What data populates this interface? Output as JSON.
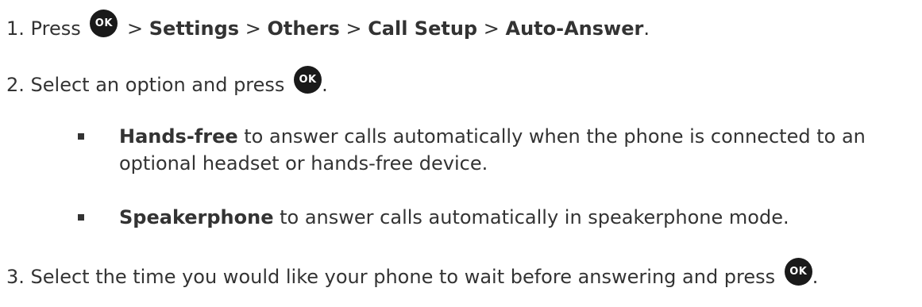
{
  "steps": {
    "s1": {
      "number": "1.",
      "press": "Press",
      "ok_label": "OK",
      "sep": ">",
      "path": [
        "Settings",
        "Others",
        "Call Setup",
        "Auto-Answer"
      ],
      "end": "."
    },
    "s2": {
      "number": "2.",
      "text": "Select an option and press",
      "ok_label": "OK",
      "end": "."
    },
    "s3": {
      "number": "3.",
      "text": "Select the time you would like your phone to wait before answering and press",
      "ok_label": "OK",
      "end": "."
    }
  },
  "options": [
    {
      "label": "Hands-free",
      "desc": "to answer calls automatically when the phone is connected to an optional headset or hands-free device."
    },
    {
      "label": "Speakerphone",
      "desc": "to answer calls automatically in speakerphone mode."
    }
  ]
}
